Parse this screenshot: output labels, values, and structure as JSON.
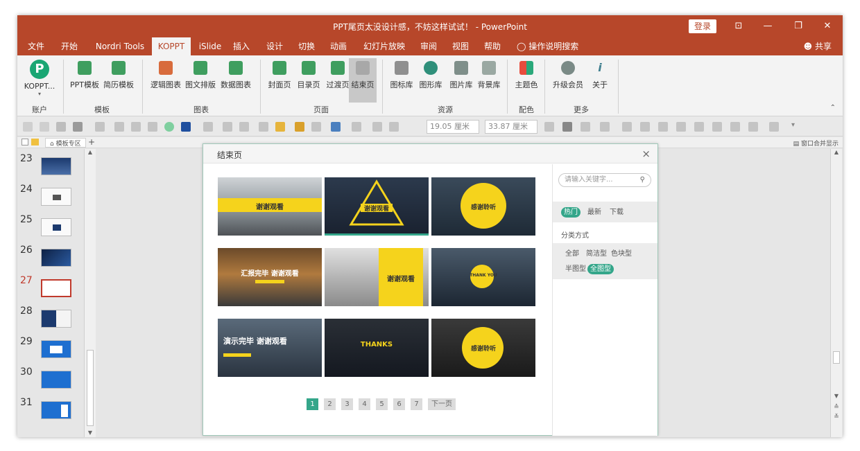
{
  "window": {
    "title": "PPT尾页太没设计感，不妨这样试试！ - PowerPoint",
    "login_label": "登录",
    "controls": {
      "ribbon_display": "⊡",
      "minimize": "—",
      "restore": "❐",
      "close": "✕"
    }
  },
  "menu": {
    "tabs": [
      "文件",
      "开始",
      "Nordri Tools",
      "KOPPT",
      "iSlide",
      "插入",
      "设计",
      "切换",
      "动画",
      "幻灯片放映",
      "审阅",
      "视图",
      "帮助"
    ],
    "active_tab": "KOPPT",
    "search_help": "操作说明搜索",
    "share": "共享"
  },
  "ribbon": {
    "account": {
      "button": "KOPPT...",
      "logo": "P",
      "group": "账户"
    },
    "template": {
      "buttons": [
        "PPT模板",
        "简历模板"
      ],
      "group": "模板"
    },
    "chart": {
      "buttons": [
        "逻辑图表",
        "图文排版",
        "数据图表"
      ],
      "group": "图表"
    },
    "page": {
      "buttons": [
        "封面页",
        "目录页",
        "过渡页",
        "结束页"
      ],
      "selected": "结束页",
      "group": "页面"
    },
    "resource": {
      "buttons": [
        "图标库",
        "图形库",
        "图片库",
        "背景库"
      ],
      "group": "资源"
    },
    "color": {
      "buttons": [
        "主题色"
      ],
      "group": "配色"
    },
    "more": {
      "buttons": [
        "升级会员",
        "关于"
      ],
      "group": "更多"
    },
    "collapse_icon": "chevron-up-icon"
  },
  "toolbar": {
    "height_value": "19.05 厘米",
    "width_value": "33.87 厘米"
  },
  "tabstrip": {
    "tab_label": "模板专区",
    "add": "+",
    "right_label": "窗口合并显示"
  },
  "slides": {
    "numbers": [
      "23",
      "24",
      "25",
      "26",
      "27",
      "28",
      "29",
      "30",
      "31"
    ],
    "active": "27"
  },
  "dialog": {
    "title": "结束页",
    "close": "×",
    "cards": [
      {
        "text": "谢谢观看",
        "theme": "bridge-yellow"
      },
      {
        "text": "谢谢观看",
        "theme": "city-triangle"
      },
      {
        "text": "感谢聆听",
        "theme": "city-circle"
      },
      {
        "text": "汇报完毕 谢谢观看",
        "theme": "road"
      },
      {
        "text": "谢谢观看",
        "theme": "bridge-bw"
      },
      {
        "text": "THANK YOU",
        "theme": "city-night"
      },
      {
        "text": "演示完毕 谢谢观看",
        "theme": "city-dusk"
      },
      {
        "text": "THANKS",
        "theme": "city-dark"
      },
      {
        "text": "感谢聆听",
        "theme": "dark-circle"
      }
    ],
    "pager": {
      "pages": [
        "1",
        "2",
        "3",
        "4",
        "5",
        "6",
        "7"
      ],
      "active": "1",
      "next": "下一页"
    },
    "search_placeholder": "请输入关键字...",
    "sort_tabs": [
      "热门",
      "最新",
      "下载"
    ],
    "sort_active": "热门",
    "category_label": "分类方式",
    "categories": [
      "全部",
      "简洁型",
      "色块型",
      "半图型",
      "全图型"
    ],
    "category_active": "全图型"
  },
  "colors": {
    "accent": "#b7472a",
    "koppt_green": "#1aa673",
    "teal": "#34a68a",
    "yellow": "#f5d31c"
  }
}
